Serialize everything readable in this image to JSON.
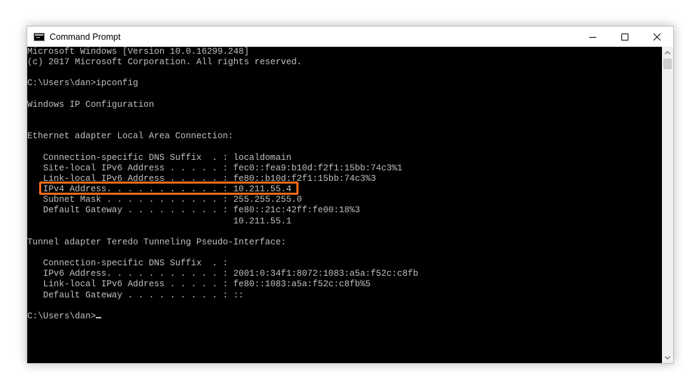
{
  "window": {
    "title": "Command Prompt",
    "app_icon": "cmd-icon",
    "controls": {
      "minimize": "minimize-icon",
      "maximize": "maximize-icon",
      "close": "close-icon"
    }
  },
  "console": {
    "lines": [
      "Microsoft Windows [Version 10.0.16299.248]",
      "(c) 2017 Microsoft Corporation. All rights reserved.",
      "",
      "C:\\Users\\dan>ipconfig",
      "",
      "Windows IP Configuration",
      "",
      "",
      "Ethernet adapter Local Area Connection:",
      "",
      "   Connection-specific DNS Suffix  . : localdomain",
      "   Site-local IPv6 Address . . . . . : fec0::fea9:b10d:f2f1:15bb:74c3%1",
      "   Link-local IPv6 Address . . . . . : fe80::b10d:f2f1:15bb:74c3%3",
      "   IPv4 Address. . . . . . . . . . . : 10.211.55.4",
      "   Subnet Mask . . . . . . . . . . . : 255.255.255.0",
      "   Default Gateway . . . . . . . . . : fe80::21c:42ff:fe00:18%3",
      "                                       10.211.55.1",
      "",
      "Tunnel adapter Teredo Tunneling Pseudo-Interface:",
      "",
      "   Connection-specific DNS Suffix  . :",
      "   IPv6 Address. . . . . . . . . . . : 2001:0:34f1:8072:1083:a5a:f52c:c8fb",
      "   Link-local IPv6 Address . . . . . : fe80::1083:a5a:f52c:c8fb%5",
      "   Default Gateway . . . . . . . . . : ::",
      ""
    ],
    "prompt": "C:\\Users\\dan>"
  },
  "annotation": {
    "highlight_color": "#f26b1d",
    "highlighted_line": "   IPv4 Address. . . . . . . . . . . : 10.211.55.4"
  },
  "colors": {
    "console_bg": "#000000",
    "console_fg": "#c0c0c0"
  }
}
